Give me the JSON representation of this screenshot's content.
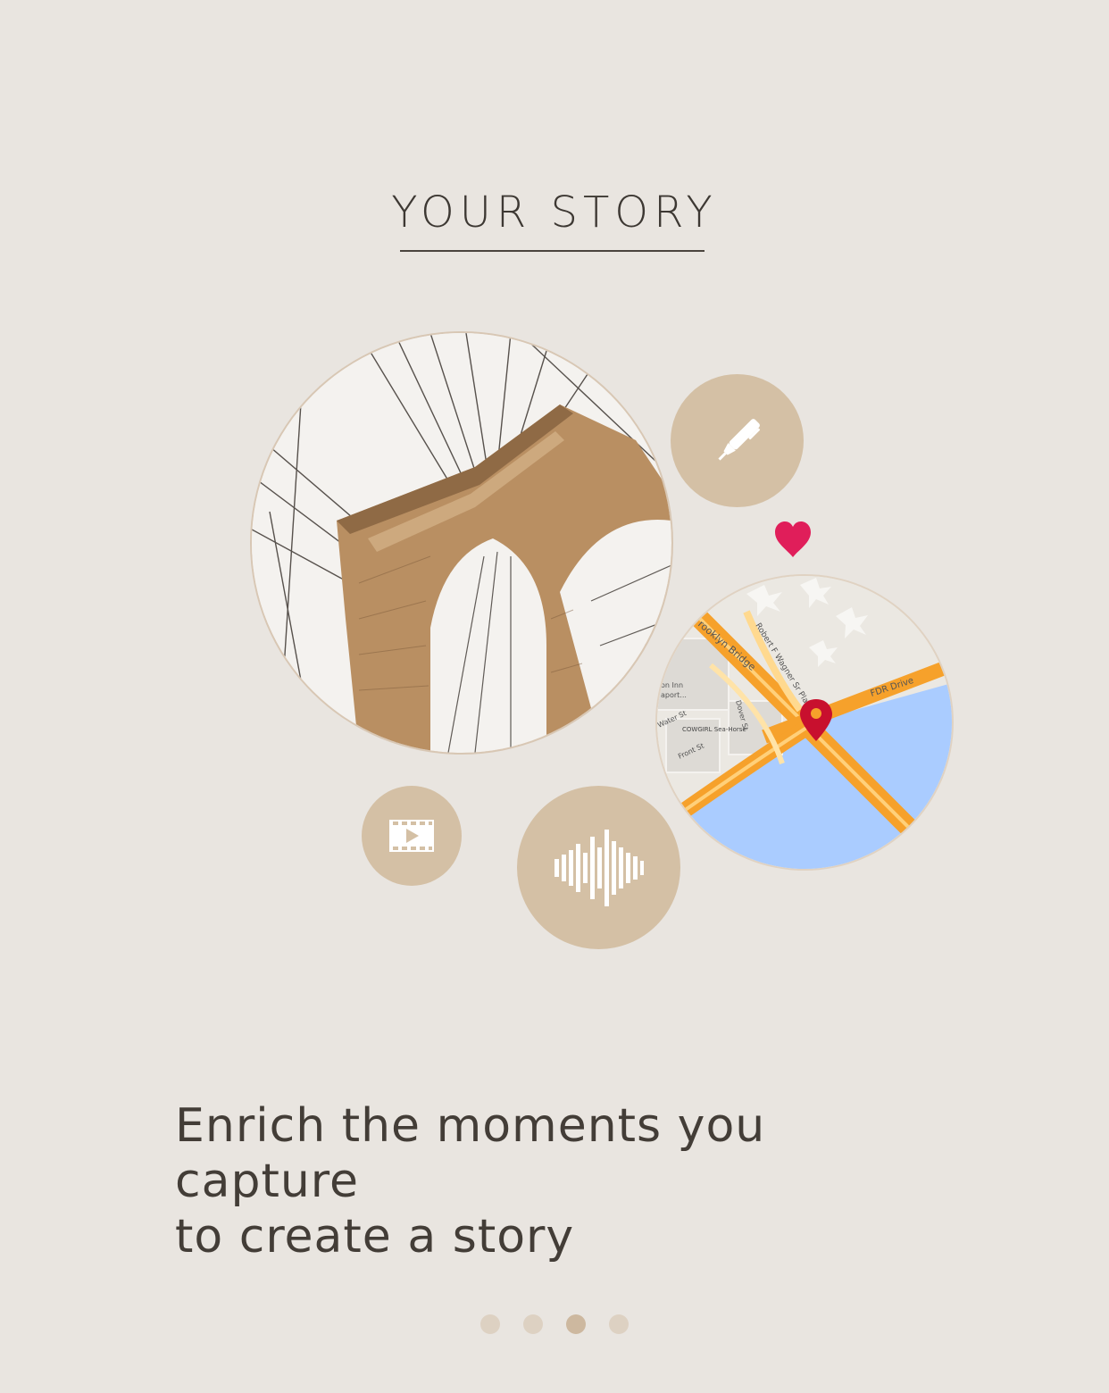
{
  "header": {
    "title": "YOUR STORY"
  },
  "illustration": {
    "photo_icon": "bridge-photo",
    "map_labels": {
      "brooklyn_bridge": "rooklyn Bridge",
      "wagner_place": "Robert F Wagner Sr Place",
      "fdr_drive": "FDR Drive",
      "inn_line1": "on Inn",
      "inn_line2": "aport...",
      "dover": "Dover St",
      "water": "Water St",
      "front": "Front St",
      "cowgirl": "COWGIRL Sea-Horse"
    },
    "icons": {
      "pen": "pen-icon",
      "video": "video-icon",
      "audio": "audio-wave-icon",
      "heart": "heart-icon",
      "pin": "map-pin-icon"
    }
  },
  "caption": {
    "line1": "Enrich the moments you capture",
    "line2": "to create a story"
  },
  "pagination": {
    "count": 4,
    "active_index": 2
  },
  "colors": {
    "background": "#e9e5e0",
    "bubble": "#d4c0a5",
    "heart": "#e01e5a",
    "pin": "#c8102e",
    "road": "#f6a12b",
    "water": "#aaccff",
    "text": "#433d37"
  }
}
